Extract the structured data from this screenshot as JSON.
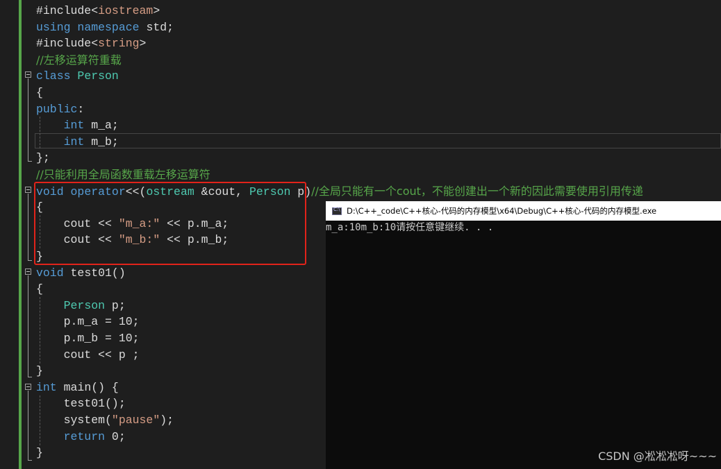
{
  "editor": {
    "lines": [
      {
        "parts": [
          {
            "t": "#include<",
            "c": "id"
          },
          {
            "t": "iostream",
            "c": "str"
          },
          {
            "t": ">",
            "c": "id"
          }
        ]
      },
      {
        "parts": [
          {
            "t": "using ",
            "c": "kw"
          },
          {
            "t": "namespace ",
            "c": "kw"
          },
          {
            "t": "std;",
            "c": "id"
          }
        ]
      },
      {
        "parts": [
          {
            "t": "#include<",
            "c": "id"
          },
          {
            "t": "string",
            "c": "str"
          },
          {
            "t": ">",
            "c": "id"
          }
        ]
      },
      {
        "parts": [
          {
            "t": "//左移运算符重载",
            "c": "cm"
          }
        ]
      },
      {
        "parts": [
          {
            "t": "class ",
            "c": "kw"
          },
          {
            "t": "Person",
            "c": "ty"
          }
        ]
      },
      {
        "parts": [
          {
            "t": "{",
            "c": "id"
          }
        ]
      },
      {
        "parts": [
          {
            "t": "public",
            "c": "kw"
          },
          {
            "t": ":",
            "c": "id"
          }
        ]
      },
      {
        "parts": [
          {
            "t": "    int ",
            "c": "kw"
          },
          {
            "t": "m_a;",
            "c": "id"
          }
        ]
      },
      {
        "parts": [
          {
            "t": "    int ",
            "c": "kw"
          },
          {
            "t": "m_b;",
            "c": "id"
          }
        ]
      },
      {
        "parts": [
          {
            "t": "};",
            "c": "id"
          }
        ]
      },
      {
        "parts": [
          {
            "t": "//只能利用全局函数重载左移运算符",
            "c": "cm"
          }
        ]
      },
      {
        "parts": [
          {
            "t": "void ",
            "c": "kw"
          },
          {
            "t": "operator",
            "c": "kw"
          },
          {
            "t": "<<(",
            "c": "id"
          },
          {
            "t": "ostream ",
            "c": "ty"
          },
          {
            "t": "&cout, ",
            "c": "id"
          },
          {
            "t": "Person ",
            "c": "ty"
          },
          {
            "t": "p)",
            "c": "id"
          },
          {
            "t": "//全局只能有一个cout，不能创建出一个新的因此需要使用引用传递",
            "c": "cm"
          }
        ]
      },
      {
        "parts": [
          {
            "t": "{",
            "c": "id"
          }
        ]
      },
      {
        "parts": [
          {
            "t": "    cout << ",
            "c": "id"
          },
          {
            "t": "\"m_a:\"",
            "c": "str"
          },
          {
            "t": " << p.m_a;",
            "c": "id"
          }
        ]
      },
      {
        "parts": [
          {
            "t": "    cout << ",
            "c": "id"
          },
          {
            "t": "\"m_b:\"",
            "c": "str"
          },
          {
            "t": " << p.m_b;",
            "c": "id"
          }
        ]
      },
      {
        "parts": [
          {
            "t": "}",
            "c": "id"
          }
        ]
      },
      {
        "parts": [
          {
            "t": "void ",
            "c": "kw"
          },
          {
            "t": "test01()",
            "c": "id"
          }
        ]
      },
      {
        "parts": [
          {
            "t": "{",
            "c": "id"
          }
        ]
      },
      {
        "parts": [
          {
            "t": "    ",
            "c": "id"
          },
          {
            "t": "Person ",
            "c": "ty"
          },
          {
            "t": "p;",
            "c": "id"
          }
        ]
      },
      {
        "parts": [
          {
            "t": "    p.m_a = 10;",
            "c": "id"
          }
        ]
      },
      {
        "parts": [
          {
            "t": "    p.m_b = 10;",
            "c": "id"
          }
        ]
      },
      {
        "parts": [
          {
            "t": "    cout << p ;",
            "c": "id"
          }
        ]
      },
      {
        "parts": [
          {
            "t": "}",
            "c": "id"
          }
        ]
      },
      {
        "parts": [
          {
            "t": "int ",
            "c": "kw"
          },
          {
            "t": "main() {",
            "c": "id"
          }
        ]
      },
      {
        "parts": [
          {
            "t": "    test01();",
            "c": "id"
          }
        ]
      },
      {
        "parts": [
          {
            "t": "    system(",
            "c": "id"
          },
          {
            "t": "\"pause\"",
            "c": "str"
          },
          {
            "t": ");",
            "c": "id"
          }
        ]
      },
      {
        "parts": [
          {
            "t": "    return ",
            "c": "kw"
          },
          {
            "t": "0;",
            "c": "id"
          }
        ]
      },
      {
        "parts": [
          {
            "t": "}",
            "c": "id"
          }
        ]
      }
    ]
  },
  "console": {
    "title": "D:\\C++_code\\C++核心-代码的内存模型\\x64\\Debug\\C++核心-代码的内存模型.exe",
    "output": "m_a:10m_b:10请按任意键继续. . ."
  },
  "watermark": "CSDN @凇凇凇呀~~~"
}
